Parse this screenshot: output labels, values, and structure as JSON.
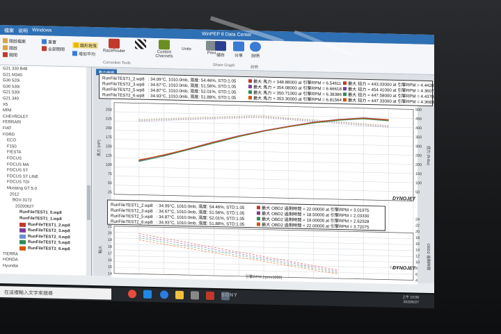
{
  "window": {
    "menus": [
      "檔案",
      "说明",
      "Windows"
    ],
    "title": "WinPEP 8 Data Center"
  },
  "ribbon": {
    "small_buttons": [
      {
        "label": "開啟檔案"
      },
      {
        "label": "開啟"
      },
      {
        "label": "關閉"
      },
      {
        "label": "重置"
      },
      {
        "label": "全部關閉"
      },
      {
        "label": "圖形拖曳"
      },
      {
        "label": "增加平均"
      }
    ],
    "big_buttons": [
      {
        "label": "RaceRouter"
      },
      {
        "label": "Custom Channels"
      },
      {
        "label": "Units"
      },
      {
        "label": "Print"
      },
      {
        "label": "儲存"
      },
      {
        "label": "分享"
      },
      {
        "label": "說明"
      }
    ],
    "groups": [
      "Correction Tools",
      "Share Graph",
      "說明"
    ]
  },
  "sidebar": {
    "items": [
      {
        "label": "G21 330 B48",
        "color": ""
      },
      {
        "label": "G21 M340",
        "color": ""
      },
      {
        "label": "G30 520i",
        "color": ""
      },
      {
        "label": "G30 530i",
        "color": ""
      },
      {
        "label": "G21 530i",
        "color": ""
      },
      {
        "label": "G21 340",
        "color": ""
      },
      {
        "label": "X5",
        "color": ""
      },
      {
        "label": "MINI",
        "color": ""
      },
      {
        "label": "CHEVROLET",
        "color": ""
      },
      {
        "label": "FERRARI",
        "color": ""
      },
      {
        "label": "FIAT",
        "color": ""
      },
      {
        "label": "FORD",
        "color": ""
      },
      {
        "label": "ECO",
        "color": ""
      },
      {
        "label": "F150",
        "color": ""
      },
      {
        "label": "FIESTA",
        "color": ""
      },
      {
        "label": "FOCUS",
        "color": ""
      },
      {
        "label": "FOCUS MA",
        "color": ""
      },
      {
        "label": "FOCUS ST",
        "color": ""
      },
      {
        "label": "FOCUS ST LINE",
        "color": ""
      },
      {
        "label": "FOCUS TDI",
        "color": ""
      },
      {
        "label": "Mustang GT 5.0",
        "color": ""
      },
      {
        "label": "2012",
        "color": ""
      },
      {
        "label": "BGV-3172",
        "color": ""
      },
      {
        "label": "20200627",
        "color": ""
      },
      {
        "label": "RunFileTEST1_0.wp8",
        "color": ""
      },
      {
        "label": "RunFileTEST1_1.wp8",
        "color": ""
      },
      {
        "label": "RunFileTEST1_2.wp8",
        "color": "#c0392b"
      },
      {
        "label": "RunFileTEST2_3.wp8",
        "color": "#7d3c98"
      },
      {
        "label": "RunFileTEST2_4.wp8",
        "color": "#6a8fd0"
      },
      {
        "label": "RunFileTEST2_5.wp8",
        "color": "#2e8b57"
      },
      {
        "label": "RunFileTEST2_6.wp8",
        "color": "#d35400"
      },
      {
        "label": "TIERRA",
        "color": ""
      },
      {
        "label": "HONDA",
        "color": ""
      },
      {
        "label": "Hyundai",
        "color": ""
      }
    ]
  },
  "chart": {
    "tab_label": "動力曲線",
    "brand": "DYNOJET",
    "upper_legend": {
      "rows": [
        "RunFileTEST1_2.wp8   : 34.09°C, 1010.0mb, 濕度: 54.46%, STD:1.05",
        "RunFileTEST2_3.wp8   : 34.67°C, 1010.0mb, 濕度: 51.56%, STD:1.05",
        "RunFileTEST2_5.wp8   : 34.87°C, 1010.0mb, 濕度: 52.01%, STD:1.05",
        "RunFileTEST2_6.wp8   : 34.93°C, 1010.0mb, 濕度: 51.88%, STD:1.05"
      ],
      "hp_stats": [
        {
          "text": "最大 馬力 = 348.88000 at 引擎RPM = 6.54611",
          "color": "#c0392b"
        },
        {
          "text": "最大 馬力 = 354.08000 at 引擎RPM = 6.66618",
          "color": "#7d3c98"
        },
        {
          "text": "最大 馬力 = 350.71000 at 引擎RPM = 6.38386",
          "color": "#2e8b57"
        },
        {
          "text": "最大 馬力 = 353.30000 at 引擎RPM = 6.81564",
          "color": "#d35400"
        }
      ],
      "tq_stats": [
        {
          "text": "最大 扭力 = 443.03000 at 引擎RPM = 4.44285",
          "color": "#c0392b"
        },
        {
          "text": "最大 扭力 = 454.41000 at 引擎RPM = 4.36077",
          "color": "#7d3c98"
        },
        {
          "text": "最大 扭力 = 447.58000 at 引擎RPM = 4.43704",
          "color": "#2e8b57"
        },
        {
          "text": "最大 扭力 = 447.33000 at 引擎RPM = 4.36830",
          "color": "#d35400"
        }
      ]
    },
    "lower_legend": {
      "rows": [
        "RunFileTEST1_2.wp8   : 34.09°C, 1010.0mb, 濕度: 54.46%, STD:1.05",
        "RunFileTEST2_3.wp8   : 34.67°C, 1010.0mb, 濕度: 51.56%, STD:1.05",
        "RunFileTEST2_5.wp8   : 34.87°C, 1010.0mb, 濕度: 52.01%, STD:1.05",
        "RunFileTEST2_6.wp8   : 34.93°C, 1010.0mb, 濕度: 51.88%, STD:1.05"
      ],
      "obd_stats": [
        {
          "text": "最大 OBD2 過剩時間 = 22.00000 at 引擎RPM = 3.01975",
          "color": "#c0392b"
        },
        {
          "text": "最大 OBD2 過剩時間 = 18.50000 at 引擎RPM = 2.03330",
          "color": "#7d3c98"
        },
        {
          "text": "最大 OBD2 過剩時間 = 19.00000 at 引擎RPM = 2.62928",
          "color": "#2e8b57"
        },
        {
          "text": "最大 OBD2 過剩時間 = 22.00000 at 引擎RPM = 3.72075",
          "color": "#d35400"
        }
      ]
    },
    "upper_y_label": "馬力 (HP)",
    "upper_y_right_label": "扭力 (ft-lbs)",
    "lower_y_label": "點火",
    "lower_y_right_label": "OBD2 過剩時間",
    "x_label": "引擎RPM (rpmx1000)",
    "upper_y_ticks": [
      "250",
      "225",
      "200",
      "175",
      "150",
      "125",
      "100",
      "75",
      "50",
      "25"
    ],
    "upper_y_right_ticks": [
      "500",
      "450",
      "400",
      "350",
      "300",
      "250",
      "200",
      "150",
      "100",
      "50"
    ],
    "lower_y_ticks": [
      "21",
      "20",
      "19",
      "18",
      "17",
      "16",
      "15",
      "14"
    ],
    "lower_y_right_ticks": [
      "24",
      "22",
      "20",
      "18",
      "16",
      "14",
      "12",
      "10",
      "8",
      "6",
      "4"
    ],
    "x_ticks": [
      "1.5",
      "2.0",
      "2.5",
      "3.0",
      "3.5",
      "4.0",
      "4.5",
      "5.0",
      "5.5",
      "6.0",
      "6.5",
      "7.0",
      "7.5"
    ],
    "readout": "7.412"
  },
  "chart_data": {
    "type": "line",
    "title": "",
    "xlabel": "引擎RPM (rpmx1000)",
    "ylabel": "馬力 (HP)",
    "xlim": [
      1.5,
      7.5
    ],
    "series": [
      {
        "name": "RunFileTEST1_2.wp8",
        "color": "#c0392b",
        "x": [
          2.0,
          2.5,
          3.0,
          3.5,
          4.0,
          4.5,
          5.0,
          5.5,
          6.0,
          6.5,
          7.0
        ],
        "values": [
          105,
          120,
          140,
          162,
          182,
          200,
          215,
          228,
          238,
          244,
          240
        ]
      },
      {
        "name": "RunFileTEST2_3.wp8",
        "color": "#7d3c98",
        "x": [
          2.0,
          2.5,
          3.0,
          3.5,
          4.0,
          4.5,
          5.0,
          5.5,
          6.0,
          6.5,
          7.0
        ],
        "values": [
          102,
          121,
          142,
          164,
          184,
          201,
          216,
          230,
          240,
          246,
          243
        ]
      },
      {
        "name": "RunFileTEST2_5.wp8",
        "color": "#2e8b57",
        "x": [
          2.0,
          2.5,
          3.0,
          3.5,
          4.0,
          4.5,
          5.0,
          5.5,
          6.0,
          6.5,
          7.0
        ],
        "values": [
          100,
          118,
          139,
          160,
          181,
          199,
          214,
          227,
          237,
          243,
          239
        ]
      },
      {
        "name": "RunFileTEST2_6.wp8",
        "color": "#d35400",
        "x": [
          2.0,
          2.5,
          3.0,
          3.5,
          4.0,
          4.5,
          5.0,
          5.5,
          6.0,
          6.5,
          7.0
        ],
        "values": [
          104,
          122,
          141,
          163,
          183,
          200,
          215,
          229,
          239,
          245,
          242
        ]
      }
    ]
  },
  "taskbar": {
    "search_placeholder": "在這裡輸入文字來搜尋",
    "time": "上午 10:09",
    "date": "2020/6/27"
  },
  "monitor": {
    "brand": "SONY"
  }
}
